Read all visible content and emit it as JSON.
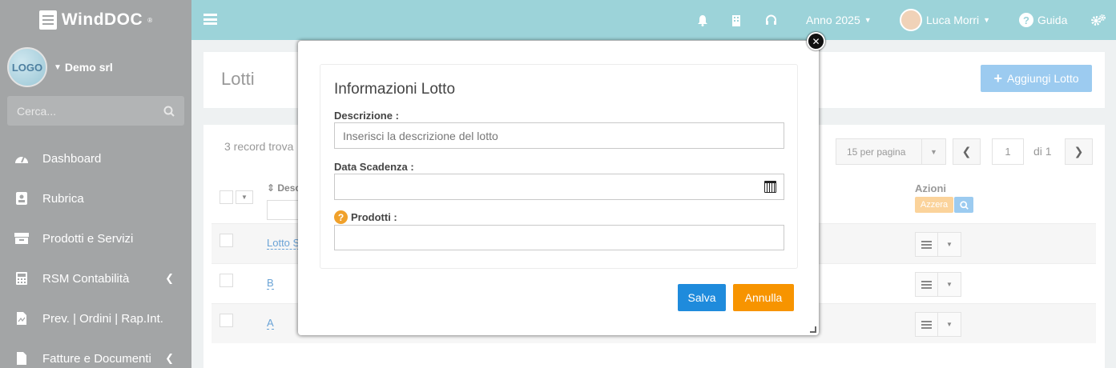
{
  "brand": {
    "name": "WindDOC",
    "reg": "®"
  },
  "company": {
    "logo_text": "LOGO",
    "name": "Demo srl"
  },
  "search": {
    "placeholder": "Cerca..."
  },
  "nav": [
    {
      "label": "Dashboard",
      "icon": "dashboard-icon"
    },
    {
      "label": "Rubrica",
      "icon": "address-book-icon"
    },
    {
      "label": "Prodotti e Servizi",
      "icon": "box-icon"
    },
    {
      "label": "RSM Contabilità",
      "icon": "calculator-icon"
    },
    {
      "label": "Prev. | Ordini | Rap.Int.",
      "icon": "document-icon"
    },
    {
      "label": "Fatture e Documenti",
      "icon": "file-icon"
    }
  ],
  "topbar": {
    "year": "Anno 2025",
    "user": "Luca Morri",
    "help": "Guida"
  },
  "page": {
    "title": "Lotti",
    "add_label": "Aggiungi Lotto",
    "records": "3 record trova",
    "per_page": "15 per pagina",
    "page_num": "1",
    "page_of": "di 1"
  },
  "table": {
    "col_desc": "Desc",
    "col_actions": "Azioni",
    "reset_label": "Azzera",
    "rows": [
      "Lotto S",
      "B",
      "A"
    ]
  },
  "modal": {
    "title": "Informazioni Lotto",
    "desc_label": "Descrizione :",
    "desc_placeholder": "Inserisci la descrizione del lotto",
    "date_label": "Data Scadenza :",
    "products_label": "Prodotti :",
    "save": "Salva",
    "cancel": "Annulla"
  },
  "colors": {
    "topbar": "#9cd3d9",
    "sidebar": "#a3a5a6",
    "primary": "#1f8bdc",
    "warning": "#f79400"
  }
}
